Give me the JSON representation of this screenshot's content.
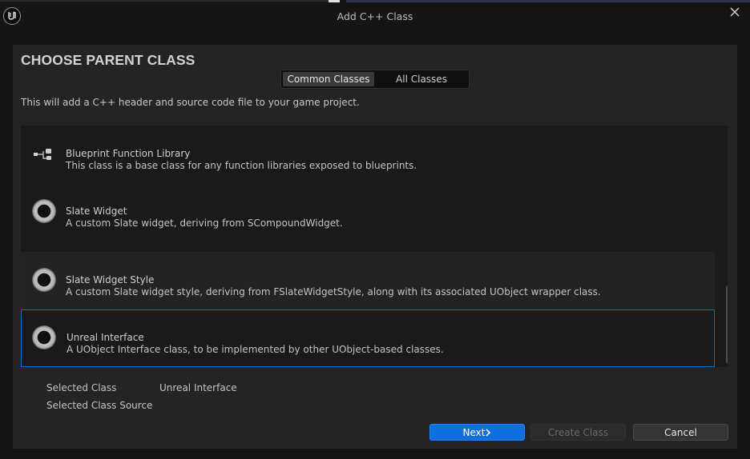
{
  "window": {
    "title": "Add C++ Class"
  },
  "header": {
    "heading": "CHOOSE PARENT CLASS",
    "tabs": [
      {
        "label": "Common Classes",
        "active": true
      },
      {
        "label": "All Classes",
        "active": false
      }
    ],
    "description": "This will add a C++ header and source code file to your game project."
  },
  "class_list": [
    {
      "icon": "blueprint-function-library-icon",
      "title": "Blueprint Function Library",
      "description": "This class is a base class for any function libraries exposed to blueprints."
    },
    {
      "icon": "class-ring-icon",
      "title": "Slate Widget",
      "description": "A custom Slate widget, deriving from SCompoundWidget."
    },
    {
      "icon": "class-ring-icon",
      "title": "Slate Widget Style",
      "description": "A custom Slate widget style, deriving from FSlateWidgetStyle, along with its associated UObject wrapper class."
    },
    {
      "icon": "class-ring-icon",
      "title": "Unreal Interface",
      "description": "A UObject Interface class, to be implemented by other UObject-based classes.",
      "selected": true
    }
  ],
  "selection": {
    "selected_class_label": "Selected Class",
    "selected_class_value": "Unreal Interface",
    "selected_source_label": "Selected Class Source"
  },
  "buttons": {
    "next": "Next",
    "create": "Create Class",
    "cancel": "Cancel"
  },
  "colors": {
    "accent": "#0e6fde",
    "selection_border": "#0b6bd2",
    "panel": "#242424",
    "background": "#151515"
  }
}
